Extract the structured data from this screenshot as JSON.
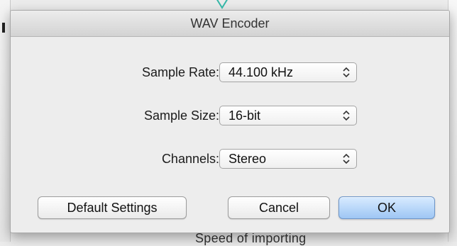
{
  "dialog": {
    "title": "WAV Encoder"
  },
  "fields": [
    {
      "label": "Sample Rate:",
      "value": "44.100 kHz"
    },
    {
      "label": "Sample Size:",
      "value": "16-bit"
    },
    {
      "label": "Channels:",
      "value": "Stereo"
    }
  ],
  "buttons": {
    "default_settings": "Default Settings",
    "cancel": "Cancel",
    "ok": "OK"
  },
  "background": {
    "bottom_text": "Speed of importing"
  },
  "colors": {
    "dialog_bg": "#ededed",
    "ok_button": "#9ec6f4",
    "indicator": "#35b6a7"
  },
  "icons": {
    "select_arrows": "up-down-chevrons-icon",
    "top_indicator": "chevron-down-icon"
  }
}
